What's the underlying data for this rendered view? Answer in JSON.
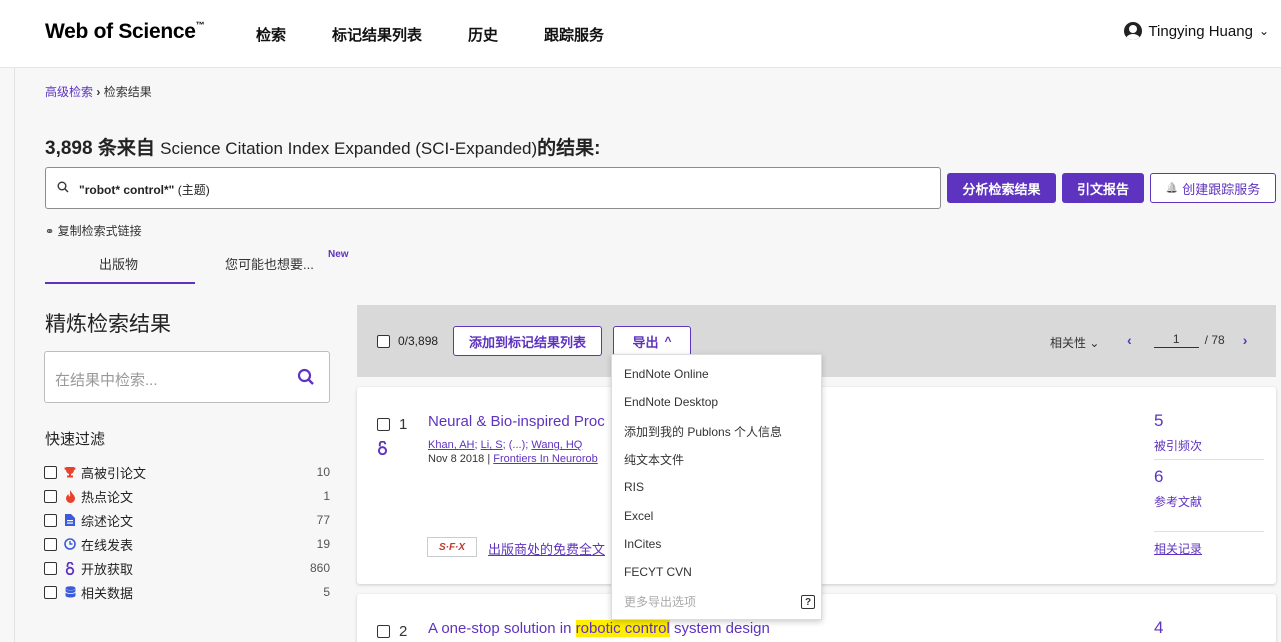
{
  "header": {
    "brand": "Web of Science",
    "brand_tm": "™",
    "nav": [
      "检索",
      "标记结果列表",
      "历史",
      "跟踪服务"
    ],
    "user_name": "Tingying Huang",
    "user_caret": "⌄"
  },
  "breadcrumb": {
    "link": "高级检索",
    "sep": "›",
    "current": "检索结果"
  },
  "result_title": {
    "count": "3,898",
    "prefix": " 条来自 ",
    "db": "Science Citation Index Expanded (SCI-Expanded)",
    "suffix": "的结果:"
  },
  "search": {
    "query": "\"robot* control*\"",
    "scope": " (主题)"
  },
  "actions": {
    "analyze": "分析检索结果",
    "citation_report": "引文报告",
    "create_alert": "创建跟踪服务",
    "bell": "🔔"
  },
  "copy_link": "复制检索式链接",
  "tabs": {
    "publications": "出版物",
    "you_may_like": "您可能也想要...",
    "new_badge": "New"
  },
  "refine": {
    "title": "精炼检索结果",
    "placeholder": "在结果中检索...",
    "quick_title": "快速过滤",
    "filters": [
      {
        "label": "高被引论文",
        "count": "10",
        "icon": "trophy-icon"
      },
      {
        "label": "热点论文",
        "count": "1",
        "icon": "flame-icon"
      },
      {
        "label": "综述论文",
        "count": "77",
        "icon": "document-icon"
      },
      {
        "label": "在线发表",
        "count": "19",
        "icon": "clock-icon"
      },
      {
        "label": "开放获取",
        "count": "860",
        "icon": "open-access-icon"
      },
      {
        "label": "相关数据",
        "count": "5",
        "icon": "database-icon"
      }
    ]
  },
  "toolbar": {
    "selected": "0/3,898",
    "add_to_marked": "添加到标记结果列表",
    "export": "导出",
    "export_caret": "^",
    "sort": "相关性",
    "sort_caret": "⌄",
    "prev": "‹",
    "page": "1",
    "total_pages": "/ 78",
    "next": "›"
  },
  "records": [
    {
      "num": "1",
      "title_visible": "Neural & Bio-inspired Proc",
      "authors_a": "Khan, AH",
      "authors_b": "Li, S",
      "authors_etc": "(...)",
      "authors_c": "Wang, HQ",
      "date": "Nov 8 2018",
      "journal": "Frontiers In Neurorob",
      "oa_icon": "open-access-icon",
      "sfx": "S·F·X",
      "free_fulltext": "出版商处的免费全文",
      "cited_count": "5",
      "cited_label": "被引频次",
      "refs_count": "6",
      "refs_label": "参考文献",
      "related": "相关记录"
    },
    {
      "num": "2",
      "title_pre": "A one-stop solution in ",
      "title_hl": "robotic control",
      "title_post": " system design",
      "cited_count": "4"
    }
  ],
  "export_menu": {
    "items": [
      "EndNote Online",
      "EndNote Desktop",
      "添加到我的 Publons 个人信息",
      "纯文本文件",
      "RIS",
      "Excel",
      "InCites",
      "FECYT CVN"
    ],
    "more": "更多导出选项",
    "help": "?"
  },
  "colors": {
    "accent": "#5e33bf",
    "highlight": "#ffee00",
    "toolbar_bg": "#d9d9d9"
  }
}
